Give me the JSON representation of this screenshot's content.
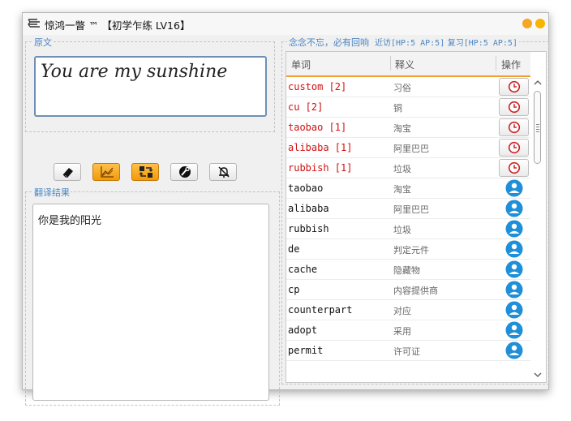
{
  "window": {
    "title": "惊鸿一瞥 ™ 【初学乍练 LV16】"
  },
  "source": {
    "label": "原文",
    "text": "You are my sunshine"
  },
  "toolbar": {
    "buttons": [
      {
        "icon": "eraser-icon",
        "active": false
      },
      {
        "icon": "chart-icon",
        "active": true
      },
      {
        "icon": "shuffle-icon",
        "active": true
      },
      {
        "icon": "wrench-icon",
        "active": false
      },
      {
        "icon": "mute-icon",
        "active": false
      }
    ]
  },
  "result": {
    "label": "翻译结果",
    "text": "你是我的阳光"
  },
  "status": {
    "motto": "念念不忘，必有回响",
    "recent": "近访[HP:5 AP:5]",
    "review": "复习[HP:5 AP:5]"
  },
  "table": {
    "headers": {
      "word": "单词",
      "meaning": "释义",
      "action": "操作"
    },
    "rows": [
      {
        "word": "custom [2]",
        "meaning": "习俗",
        "red": true,
        "action": "clock-icon"
      },
      {
        "word": "cu [2]",
        "meaning": "铜",
        "red": true,
        "action": "clock-icon"
      },
      {
        "word": "taobao [1]",
        "meaning": "淘宝",
        "red": true,
        "action": "clock-icon"
      },
      {
        "word": "alibaba [1]",
        "meaning": "阿里巴巴",
        "red": true,
        "action": "clock-icon"
      },
      {
        "word": "rubbish [1]",
        "meaning": "垃圾",
        "red": true,
        "action": "clock-icon"
      },
      {
        "word": "taobao",
        "meaning": "淘宝",
        "red": false,
        "action": "user-icon"
      },
      {
        "word": "alibaba",
        "meaning": "阿里巴巴",
        "red": false,
        "action": "user-icon"
      },
      {
        "word": "rubbish",
        "meaning": "垃圾",
        "red": false,
        "action": "user-icon"
      },
      {
        "word": "de",
        "meaning": "判定元件",
        "red": false,
        "action": "user-icon"
      },
      {
        "word": "cache",
        "meaning": "隐藏物",
        "red": false,
        "action": "user-icon"
      },
      {
        "word": "cp",
        "meaning": "内容提供商",
        "red": false,
        "action": "user-icon"
      },
      {
        "word": "counterpart",
        "meaning": "对应",
        "red": false,
        "action": "user-icon"
      },
      {
        "word": "adopt",
        "meaning": "采用",
        "red": false,
        "action": "user-icon"
      },
      {
        "word": "permit",
        "meaning": "许可证",
        "red": false,
        "action": "user-icon"
      }
    ]
  },
  "colors": {
    "accent": "#4a86c5",
    "highlight": "#f39a07",
    "error_text": "#d01010",
    "user_badge": "#1e8fd8"
  }
}
